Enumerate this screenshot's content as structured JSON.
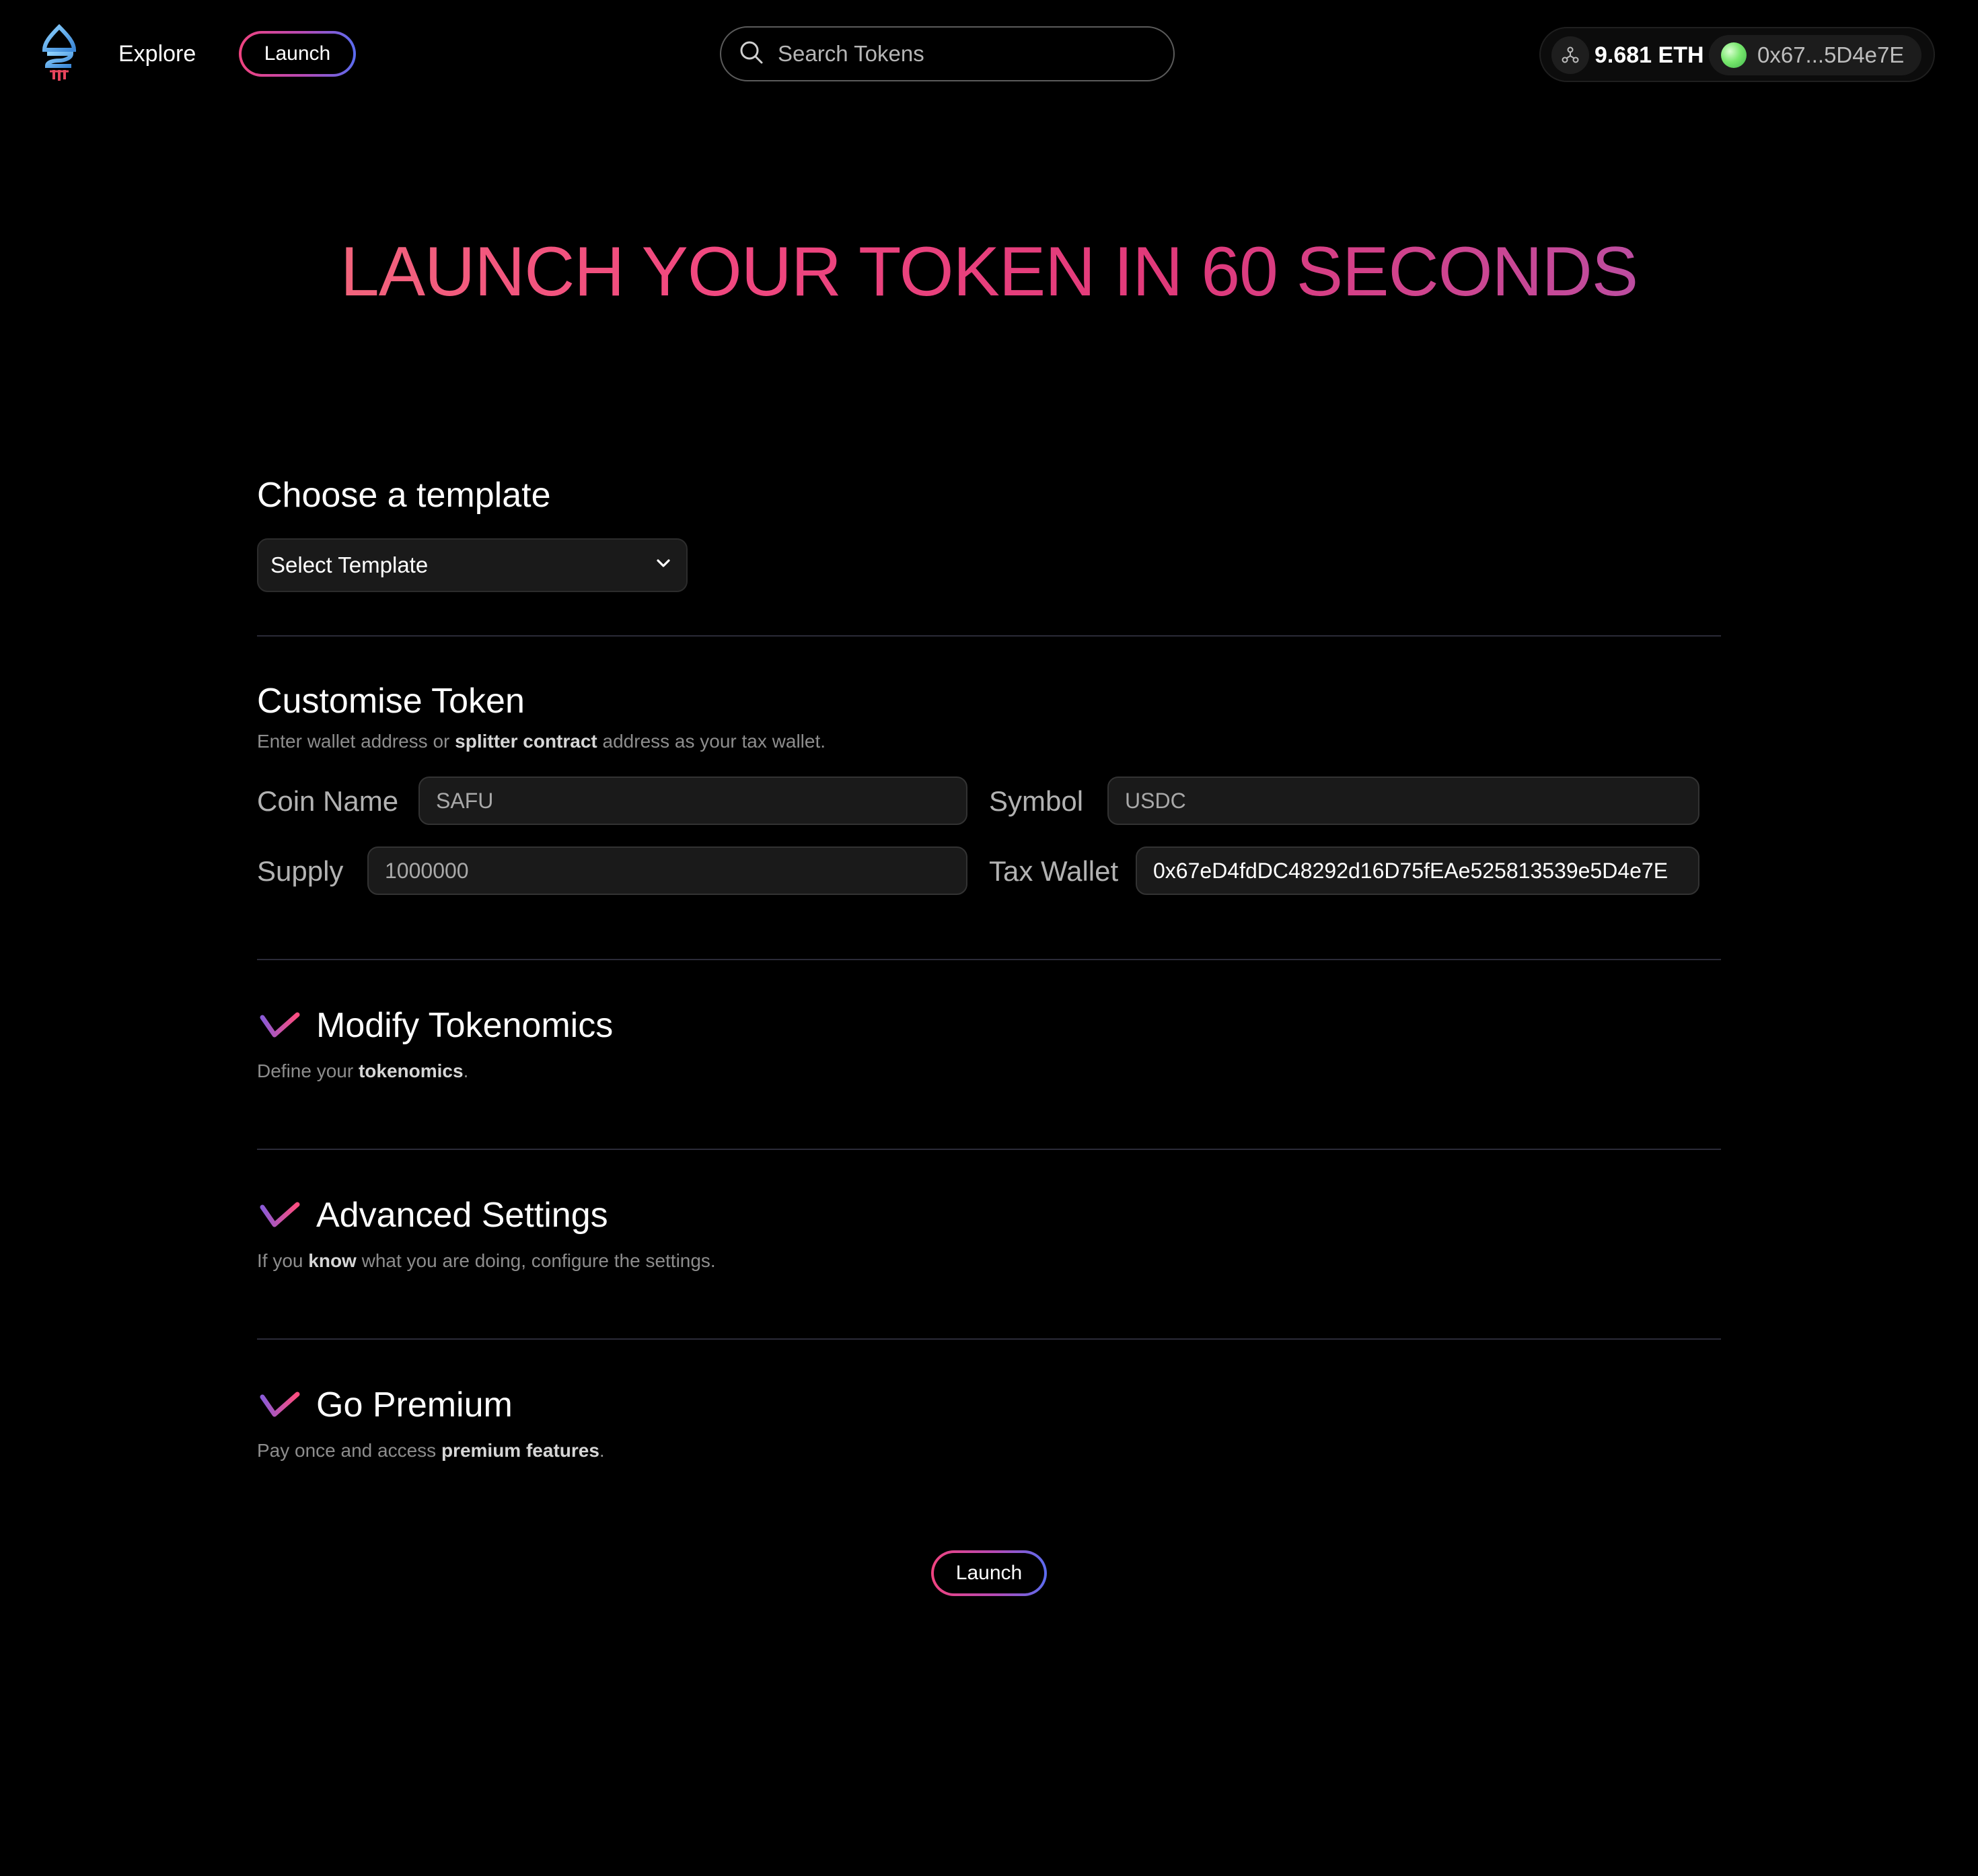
{
  "header": {
    "nav_explore": "Explore",
    "nav_launch": "Launch",
    "search_placeholder": "Search Tokens",
    "eth_balance": "9.681 ETH",
    "wallet_address": "0x67...5D4e7E"
  },
  "hero": {
    "title": "LAUNCH YOUR TOKEN IN 60 SECONDS"
  },
  "template_section": {
    "title": "Choose a template",
    "select_value": "Select Template"
  },
  "customise": {
    "title": "Customise Token",
    "desc_pre": "Enter wallet address or ",
    "desc_bold": "splitter contract",
    "desc_post": " address as your tax wallet.",
    "coin_name_label": "Coin Name",
    "coin_name_placeholder": "SAFU",
    "symbol_label": "Symbol",
    "symbol_placeholder": "USDC",
    "supply_label": "Supply",
    "supply_placeholder": "1000000",
    "tax_wallet_label": "Tax Wallet",
    "tax_wallet_value": "0x67eD4fdDC48292d16D75fEAe525813539e5D4e7E"
  },
  "tokenomics": {
    "title": "Modify Tokenomics",
    "desc_pre": "Define your ",
    "desc_bold": "tokenomics",
    "desc_post": "."
  },
  "advanced": {
    "title": "Advanced Settings",
    "desc_pre": "If you ",
    "desc_bold": "know",
    "desc_post": " what you are doing, configure the settings."
  },
  "premium": {
    "title": "Go Premium",
    "desc_pre": "Pay once and access ",
    "desc_bold": "premium features",
    "desc_post": "."
  },
  "footer": {
    "launch_label": "Launch"
  },
  "colors": {
    "background": "#000000",
    "accent_pink": "#f0437f",
    "accent_blue": "#5a6cf0",
    "status_green": "#79e86e",
    "divider": "#2b2b38"
  },
  "icons": [
    "logo-icon",
    "search-icon",
    "network-icon",
    "chevron-down-icon",
    "expand-chevron-icon"
  ]
}
